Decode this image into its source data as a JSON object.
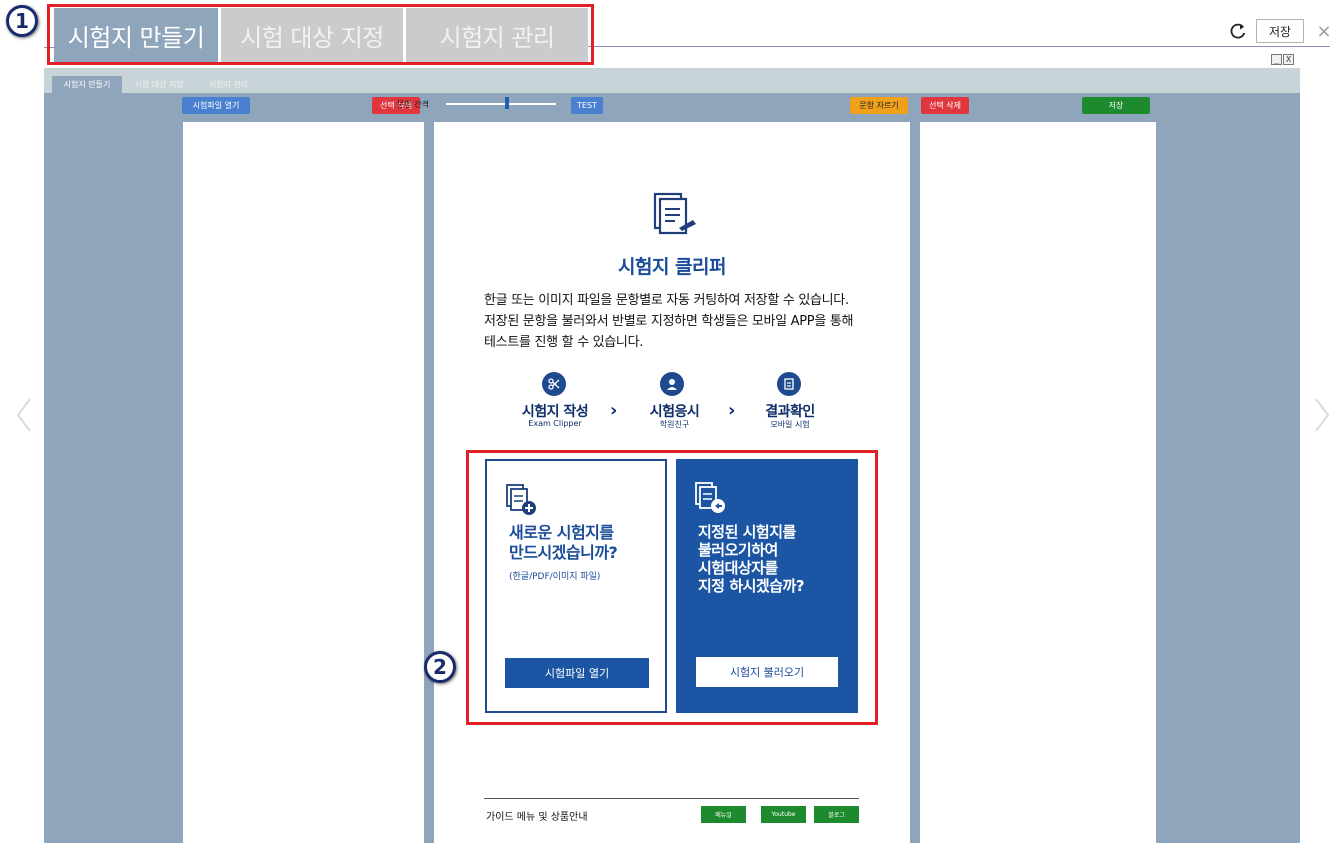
{
  "top_tabs": [
    "시험지 만들기",
    "시험 대상 지정",
    "시험지 관리"
  ],
  "top_save_label": "저장",
  "close_glyph": "×",
  "win_buttons": [
    "_",
    "X"
  ],
  "sub_tabs": [
    "시험지 만들기",
    "시험 대상 지정",
    "시험지 관리"
  ],
  "toolbar": {
    "open_file": "시험파일 열기",
    "delete_left": "선택 삭제",
    "spacing_label": "문항 간격",
    "test": "TEST",
    "cut_items": "문항 자르기",
    "delete_right": "선택 삭제",
    "save": "저장"
  },
  "slider": {
    "level": 0.55
  },
  "center": {
    "title": "시험지 클리퍼",
    "intro_lines": [
      "한글 또는 이미지 파일을 문항별로 자동 커팅하여 저장할 수 있습니다.",
      "저장된 문항을 불러와서 반별로 지정하면 학생들은 모바일 APP을 통해",
      "테스트를 진행 할 수 있습니다."
    ],
    "steps": [
      {
        "title": "시험지 작성",
        "sub": "Exam Clipper"
      },
      {
        "title": "시험응시",
        "sub": "학원친구"
      },
      {
        "title": "결과확인",
        "sub": "모바일 시험"
      }
    ],
    "step_arrow": "›",
    "card_new": {
      "title_lines": [
        "새로운 시험지를",
        "만드시겠습니까?"
      ],
      "sub": "(한글/PDF/이미지 파일)",
      "button": "시험파일 열기"
    },
    "card_load": {
      "title_lines": [
        "지정된 시험지를",
        "불러오기하여",
        "시험대상자를",
        "지정 하시겠습까?"
      ],
      "button": "시험지 불러오기"
    },
    "guide": {
      "label": "가이드 메뉴 및 상품안내",
      "buttons": [
        "매뉴얼",
        "Youtube",
        "블로그"
      ]
    }
  },
  "annotations": [
    "1",
    "2"
  ],
  "colors": {
    "panel_blue": "#8fa5bb",
    "brand_blue": "#1b55a3",
    "red": "#e0373f",
    "orange": "#f0a11c",
    "green": "#1e8a2e",
    "annotation_red": "#e01f26"
  }
}
